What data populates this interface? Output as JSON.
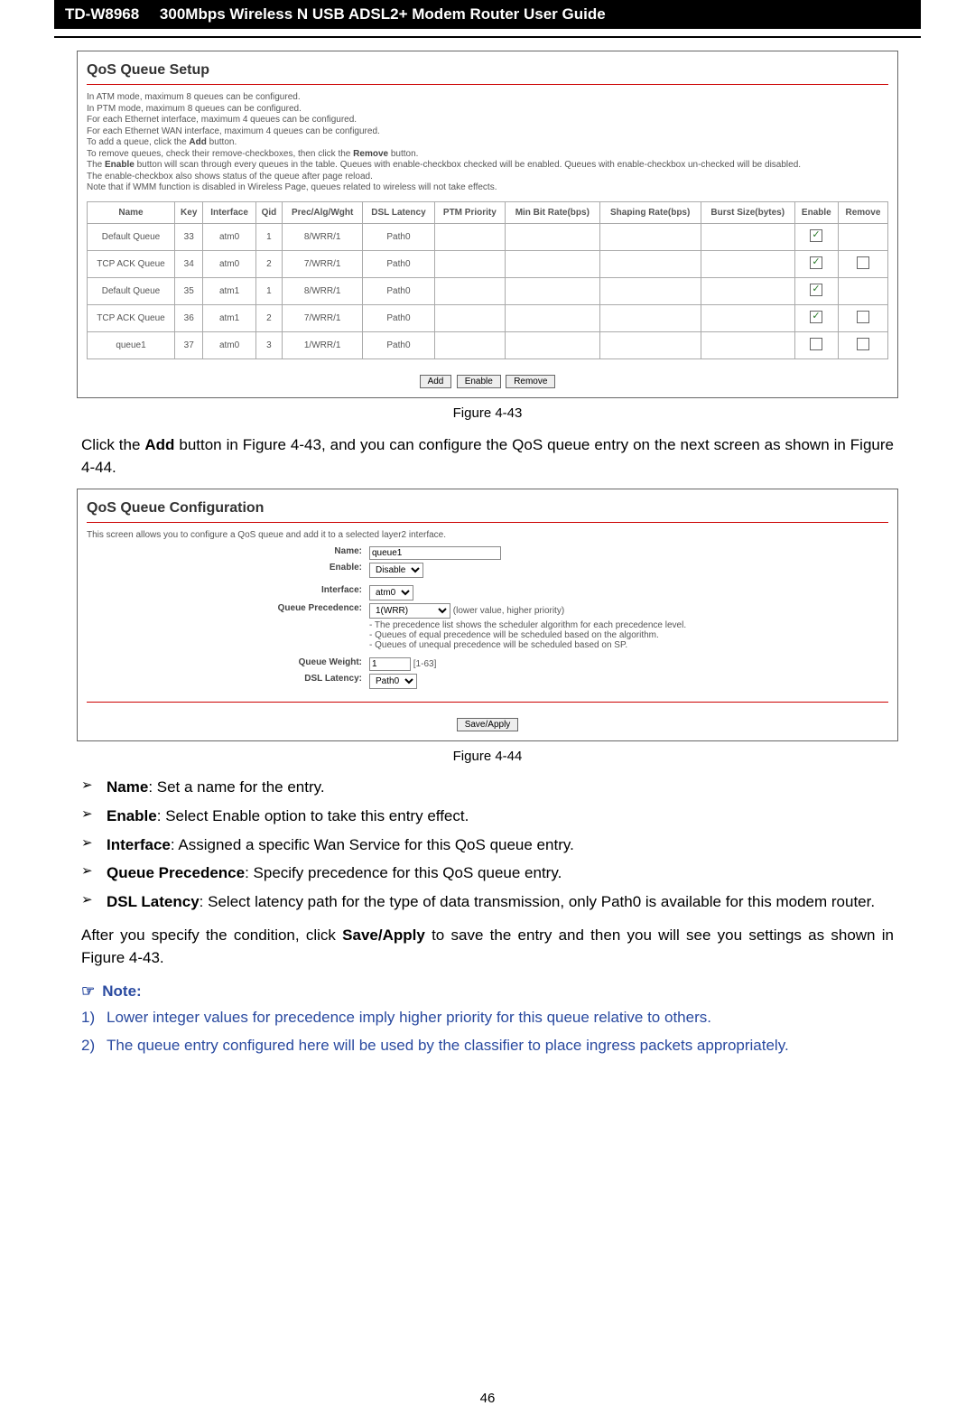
{
  "header": {
    "model": "TD-W8968",
    "title": "300Mbps Wireless N USB ADSL2+ Modem Router User Guide"
  },
  "panel1": {
    "title": "QoS Queue Setup",
    "intro": [
      "In ATM mode, maximum 8 queues can be configured.",
      "In PTM mode, maximum 8 queues can be configured.",
      "For each Ethernet interface, maximum 4 queues can be configured.",
      "For each Ethernet WAN interface, maximum 4 queues can be configured.",
      "To add a queue, click the Add button.",
      "To remove queues, check their remove-checkboxes, then click the Remove button.",
      "The Enable button will scan through every queues in the table. Queues with enable-checkbox checked will be enabled. Queues with enable-checkbox un-checked will be disabled.",
      "The enable-checkbox also shows status of the queue after page reload.",
      "Note that if WMM function is disabled in Wireless Page, queues related to wireless will not take effects."
    ],
    "columns": [
      "Name",
      "Key",
      "Interface",
      "Qid",
      "Prec/Alg/Wght",
      "DSL Latency",
      "PTM Priority",
      "Min Bit Rate(bps)",
      "Shaping Rate(bps)",
      "Burst Size(bytes)",
      "Enable",
      "Remove"
    ],
    "rows": [
      {
        "name": "Default Queue",
        "key": "33",
        "iface": "atm0",
        "qid": "1",
        "prec": "8/WRR/1",
        "lat": "Path0",
        "ptm": "",
        "min": "",
        "shape": "",
        "burst": "",
        "enable": true,
        "remove": null
      },
      {
        "name": "TCP ACK Queue",
        "key": "34",
        "iface": "atm0",
        "qid": "2",
        "prec": "7/WRR/1",
        "lat": "Path0",
        "ptm": "",
        "min": "",
        "shape": "",
        "burst": "",
        "enable": true,
        "remove": false
      },
      {
        "name": "Default Queue",
        "key": "35",
        "iface": "atm1",
        "qid": "1",
        "prec": "8/WRR/1",
        "lat": "Path0",
        "ptm": "",
        "min": "",
        "shape": "",
        "burst": "",
        "enable": true,
        "remove": null
      },
      {
        "name": "TCP ACK Queue",
        "key": "36",
        "iface": "atm1",
        "qid": "2",
        "prec": "7/WRR/1",
        "lat": "Path0",
        "ptm": "",
        "min": "",
        "shape": "",
        "burst": "",
        "enable": true,
        "remove": false
      },
      {
        "name": "queue1",
        "key": "37",
        "iface": "atm0",
        "qid": "3",
        "prec": "1/WRR/1",
        "lat": "Path0",
        "ptm": "",
        "min": "",
        "shape": "",
        "burst": "",
        "enable": false,
        "remove": false
      }
    ],
    "buttons": {
      "add": "Add",
      "enable": "Enable",
      "remove": "Remove"
    }
  },
  "fig1": "Figure 4-43",
  "para1": "Click the Add button in Figure 4-43, and you can configure the QoS queue entry on the next screen as shown in Figure 4-44.",
  "panel2": {
    "title": "QoS Queue Configuration",
    "lead": "This screen allows you to configure a QoS queue and add it to a selected layer2 interface.",
    "labels": {
      "name": "Name:",
      "enable": "Enable:",
      "interface": "Interface:",
      "precedence": "Queue Precedence:",
      "weight": "Queue Weight:",
      "latency": "DSL Latency:"
    },
    "values": {
      "name": "queue1",
      "enable": "Disable",
      "interface": "atm0",
      "precedence": "1(WRR)",
      "prec_hint": "(lower value, higher priority)",
      "prec_notes": [
        "- The precedence list shows the scheduler algorithm for each precedence level.",
        "- Queues of equal precedence will be scheduled based on the algorithm.",
        "- Queues of unequal precedence will be scheduled based on SP."
      ],
      "weight": "1",
      "weight_range": "[1-63]",
      "latency": "Path0"
    },
    "save": "Save/Apply"
  },
  "fig2": "Figure 4-44",
  "bullets": [
    {
      "term": "Name",
      "text": ": Set a name for the entry."
    },
    {
      "term": "Enable",
      "text": ": Select Enable option to take this entry effect."
    },
    {
      "term": "Interface",
      "text": ": Assigned a specific Wan Service for this QoS queue entry."
    },
    {
      "term": "Queue Precedence",
      "text": ": Specify precedence for this QoS queue entry."
    },
    {
      "term": "DSL Latency",
      "text": ": Select latency path for the type of data transmission, only Path0 is available for this modem router."
    }
  ],
  "para2": "After you specify the condition, click Save/Apply to save the entry and then you will see you settings as shown in Figure 4-43.",
  "note_head": "Note:",
  "notes": [
    {
      "n": "1)",
      "text": "Lower integer values for precedence imply higher priority for this queue relative to others."
    },
    {
      "n": "2)",
      "text": "The queue entry configured here will be used by the classifier to place ingress packets appropriately."
    }
  ],
  "page": "46"
}
